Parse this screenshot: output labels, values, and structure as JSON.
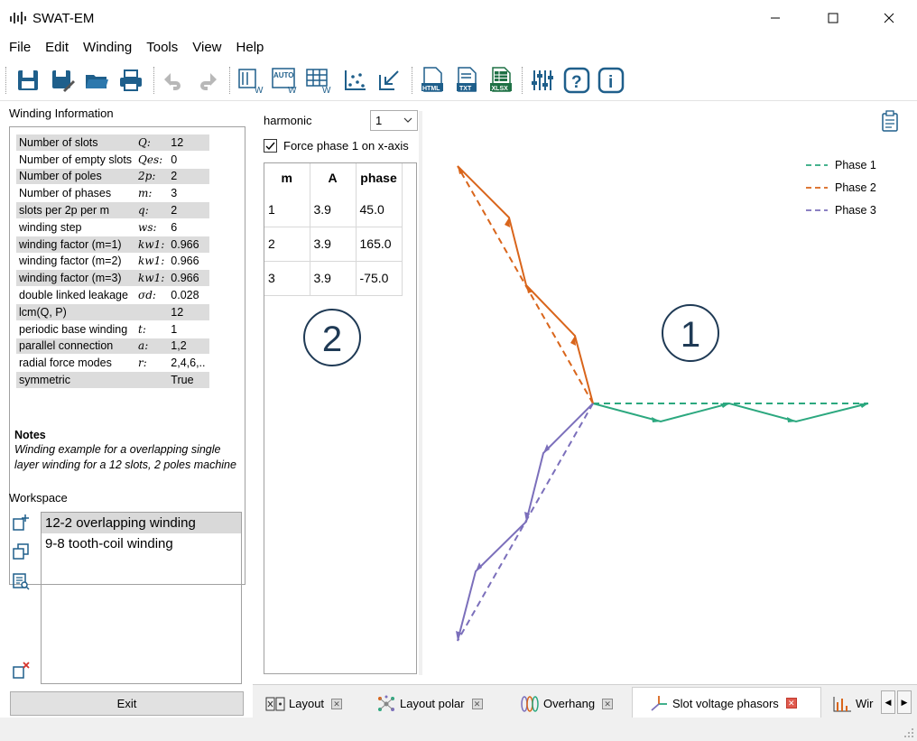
{
  "window": {
    "title": "SWAT-EM",
    "minimize_glyph": "—",
    "maximize_glyph": "☐",
    "close_glyph": "✕"
  },
  "menu": [
    "File",
    "Edit",
    "Winding",
    "Tools",
    "View",
    "Help"
  ],
  "toolbar": {
    "icons": [
      "save-icon",
      "save-as-icon",
      "open-folder-icon",
      "print-icon",
      "undo-icon",
      "redo-icon",
      "winding-edit-icon",
      "auto-winding-icon",
      "winding-table-icon",
      "scatter-icon",
      "import-icon",
      "export-html-icon",
      "export-txt-icon",
      "export-xlsx-icon",
      "settings-sliders-icon",
      "help-icon",
      "info-icon"
    ],
    "icon_labels": {
      "auto": "AUTO",
      "w": "W",
      "html": "HTML",
      "txt": "TXT",
      "xlsx": "XLSX",
      "help": "?",
      "info": "i"
    }
  },
  "winding_info": {
    "title": "Winding Information",
    "rows": [
      {
        "label": "Number of slots",
        "symbol": "Q:",
        "value": "12"
      },
      {
        "label": "Number of empty slots",
        "symbol": "Qes:",
        "value": "0"
      },
      {
        "label": "Number of poles",
        "symbol": "2p:",
        "value": "2"
      },
      {
        "label": "Number of phases",
        "symbol": "m:",
        "value": "3"
      },
      {
        "label": "slots per 2p per m",
        "symbol": "q:",
        "value": "2"
      },
      {
        "label": "winding step",
        "symbol": "ws:",
        "value": "6"
      },
      {
        "label": "winding factor (m=1)",
        "symbol": "kw1:",
        "value": "0.966"
      },
      {
        "label": "winding factor (m=2)",
        "symbol": "kw1:",
        "value": "0.966"
      },
      {
        "label": "winding factor (m=3)",
        "symbol": "kw1:",
        "value": "0.966"
      },
      {
        "label": "double linked leakage",
        "symbol": "σd:",
        "value": "0.028"
      },
      {
        "label": "lcm(Q, P)",
        "symbol": "",
        "value": "12"
      },
      {
        "label": "periodic base winding",
        "symbol": "t:",
        "value": "1"
      },
      {
        "label": "parallel connection",
        "symbol": "a:",
        "value": "1,2"
      },
      {
        "label": "radial force modes",
        "symbol": "r:",
        "value": "2,4,6,.."
      },
      {
        "label": "symmetric",
        "symbol": "",
        "value": "True"
      }
    ],
    "notes_title": "Notes",
    "notes_text": "Winding example for a overlapping single layer winding for a 12 slots, 2 poles machine"
  },
  "workspace": {
    "title": "Workspace",
    "items": [
      "12-2 overlapping winding",
      "9-8 tooth-coil winding"
    ],
    "selected_index": 0
  },
  "exit_label": "Exit",
  "harmonic": {
    "label": "harmonic",
    "value": "1",
    "force_label": "Force phase 1 on x-axis",
    "force_checked": true,
    "headers": [
      "m",
      "A",
      "phase"
    ],
    "rows": [
      [
        "1",
        "3.9",
        "45.0"
      ],
      [
        "2",
        "3.9",
        "165.0"
      ],
      [
        "3",
        "3.9",
        "-75.0"
      ]
    ]
  },
  "callouts": {
    "left": "2",
    "right": "1"
  },
  "legend": [
    {
      "name": "Phase 1",
      "color": "#2ca87f"
    },
    {
      "name": "Phase 2",
      "color": "#d9651b"
    },
    {
      "name": "Phase 3",
      "color": "#7b6fbb"
    }
  ],
  "tabs": [
    {
      "label": "Layout",
      "icon": "layout-icon",
      "active": false
    },
    {
      "label": "Layout polar",
      "icon": "layout-polar-icon",
      "active": false
    },
    {
      "label": "Overhang",
      "icon": "overhang-icon",
      "active": false
    },
    {
      "label": "Slot voltage phasors",
      "icon": "phasor-icon",
      "active": true
    },
    {
      "label": "Wir",
      "icon": "bar-chart-icon",
      "active": false
    }
  ],
  "tab_close_glyph": "✕",
  "tab_scroll": {
    "left": "◀",
    "right": "▶"
  }
}
